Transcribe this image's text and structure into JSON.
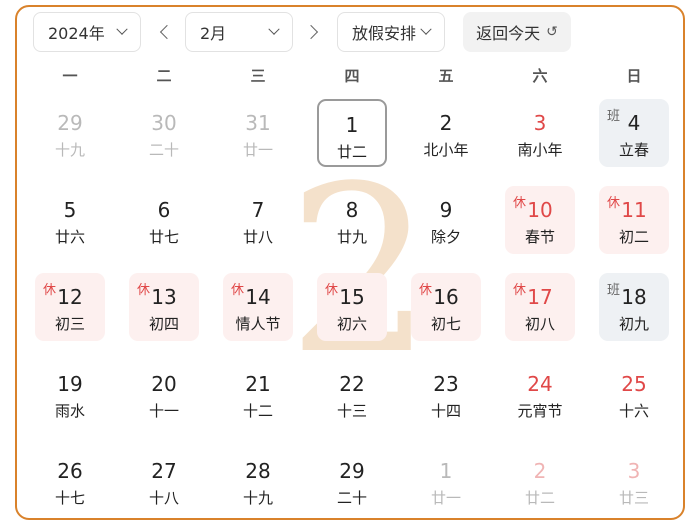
{
  "toolbar": {
    "year": "2024年",
    "month": "2月",
    "holiday": "放假安排",
    "today": "返回今天",
    "return_glyph": "↺"
  },
  "weekdays": [
    "一",
    "二",
    "三",
    "四",
    "五",
    "六",
    "日"
  ],
  "big_month": "2",
  "colors": {
    "accent": "#d9822b",
    "holiday": "#e04848",
    "rest_bg": "#fdf0ef",
    "work_bg": "#eef1f4"
  },
  "weeks": [
    [
      {
        "num": "29",
        "lunar": "十九",
        "other": true
      },
      {
        "num": "30",
        "lunar": "二十",
        "other": true
      },
      {
        "num": "31",
        "lunar": "廿一",
        "other": true
      },
      {
        "num": "1",
        "lunar": "廿二",
        "selected": true
      },
      {
        "num": "2",
        "lunar": "北小年"
      },
      {
        "num": "3",
        "lunar": "南小年",
        "weekend": true
      },
      {
        "num": "4",
        "lunar": "立春",
        "badge": "班",
        "work": true
      }
    ],
    [
      {
        "num": "5",
        "lunar": "廿六"
      },
      {
        "num": "6",
        "lunar": "廿七"
      },
      {
        "num": "7",
        "lunar": "廿八"
      },
      {
        "num": "8",
        "lunar": "廿九"
      },
      {
        "num": "9",
        "lunar": "除夕"
      },
      {
        "num": "10",
        "lunar": "春节",
        "badge": "休",
        "rest": true,
        "weekend": true
      },
      {
        "num": "11",
        "lunar": "初二",
        "badge": "休",
        "rest": true,
        "weekend": true
      }
    ],
    [
      {
        "num": "12",
        "lunar": "初三",
        "badge": "休",
        "rest": true
      },
      {
        "num": "13",
        "lunar": "初四",
        "badge": "休",
        "rest": true
      },
      {
        "num": "14",
        "lunar": "情人节",
        "badge": "休",
        "rest": true
      },
      {
        "num": "15",
        "lunar": "初六",
        "badge": "休",
        "rest": true
      },
      {
        "num": "16",
        "lunar": "初七",
        "badge": "休",
        "rest": true
      },
      {
        "num": "17",
        "lunar": "初八",
        "badge": "休",
        "rest": true,
        "weekend": true
      },
      {
        "num": "18",
        "lunar": "初九",
        "badge": "班",
        "work": true
      }
    ],
    [
      {
        "num": "19",
        "lunar": "雨水"
      },
      {
        "num": "20",
        "lunar": "十一"
      },
      {
        "num": "21",
        "lunar": "十二"
      },
      {
        "num": "22",
        "lunar": "十三"
      },
      {
        "num": "23",
        "lunar": "十四"
      },
      {
        "num": "24",
        "lunar": "元宵节",
        "weekend": true
      },
      {
        "num": "25",
        "lunar": "十六",
        "weekend": true
      }
    ],
    [
      {
        "num": "26",
        "lunar": "十七"
      },
      {
        "num": "27",
        "lunar": "十八"
      },
      {
        "num": "28",
        "lunar": "十九"
      },
      {
        "num": "29",
        "lunar": "二十"
      },
      {
        "num": "1",
        "lunar": "廿一",
        "other": true
      },
      {
        "num": "2",
        "lunar": "廿二",
        "other": true,
        "weekend": true
      },
      {
        "num": "3",
        "lunar": "廿三",
        "other": true,
        "weekend": true
      }
    ]
  ]
}
